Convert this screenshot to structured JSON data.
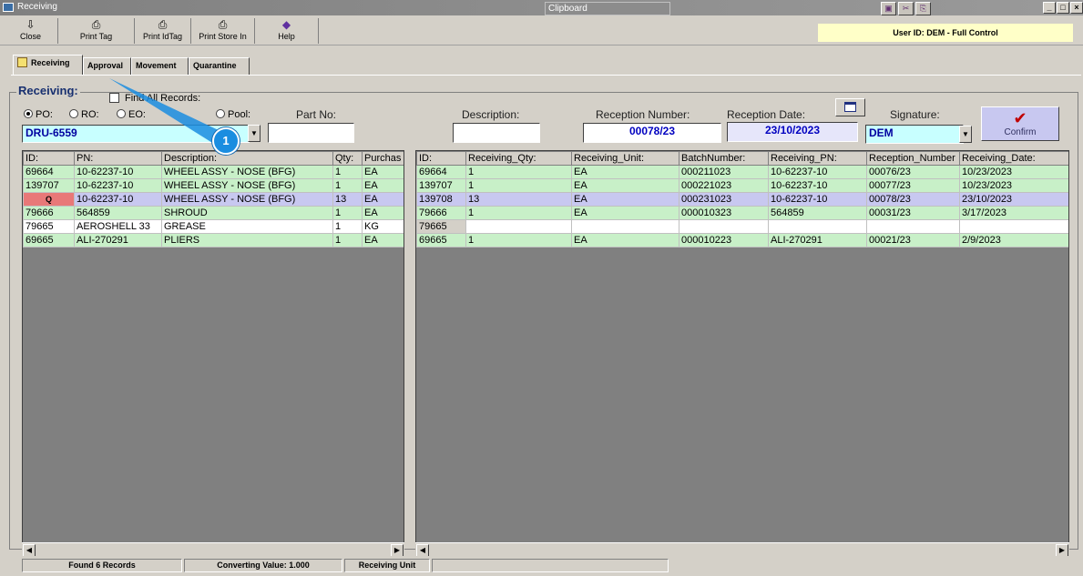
{
  "window": {
    "title": "Receiving",
    "clipboard_label": "Clipboard",
    "controls": [
      "_",
      "□",
      "×"
    ]
  },
  "toolbar": {
    "buttons": [
      {
        "label": "Close",
        "icon": "close-icon"
      },
      {
        "label": "Print Tag",
        "icon": "printer-icon"
      },
      {
        "label": "Print IdTag",
        "icon": "printer-icon"
      },
      {
        "label": "Print Store In",
        "icon": "printer-icon"
      },
      {
        "label": "Help",
        "icon": "help-icon"
      }
    ],
    "user_info": "User ID: DEM - Full Control"
  },
  "tabs": [
    {
      "label": "Receiving",
      "active": true
    },
    {
      "label": "Approval",
      "active": false
    },
    {
      "label": "Movement",
      "active": false
    },
    {
      "label": "Quarantine",
      "active": false
    }
  ],
  "form": {
    "group_title": "Receiving:",
    "all_records_label": "Find All Records:",
    "source_options": [
      {
        "label": "PO:",
        "selected": true
      },
      {
        "label": "RO:",
        "selected": false
      },
      {
        "label": "EO:",
        "selected": false
      },
      {
        "label": "Pool:",
        "selected": false
      }
    ],
    "order_number": "DRU-6559",
    "part_no_label": "Part No:",
    "part_no_value": "",
    "description_label": "Description:",
    "description_value": "",
    "reception_number_label": "Reception Number:",
    "reception_number_value": "00078/23",
    "reception_date_label": "Reception Date:",
    "reception_date_value": "23/10/2023",
    "signature_label": "Signature:",
    "signature_value": "DEM",
    "confirm_label": "Confirm"
  },
  "left_grid": {
    "columns": [
      "ID:",
      "PN:",
      "Description:",
      "Qty:",
      "Purchas"
    ],
    "rows": [
      {
        "id": "69664",
        "pn": "10-62237-10",
        "desc": "WHEEL ASSY - NOSE (BFG)",
        "qty": "1",
        "unit": "EA",
        "style": "g"
      },
      {
        "id": "139707",
        "pn": "10-62237-10",
        "desc": "WHEEL ASSY - NOSE (BFG)",
        "qty": "1",
        "unit": "EA",
        "style": "g"
      },
      {
        "id": "Q",
        "pn": "10-62237-10",
        "desc": "WHEEL ASSY - NOSE (BFG)",
        "qty": "13",
        "unit": "EA",
        "style": "sel"
      },
      {
        "id": "79666",
        "pn": "564859",
        "desc": "SHROUD",
        "qty": "1",
        "unit": "EA",
        "style": "g"
      },
      {
        "id": "79665",
        "pn": "AEROSHELL 33",
        "desc": "GREASE",
        "qty": "1",
        "unit": "KG",
        "style": "w"
      },
      {
        "id": "69665",
        "pn": "ALI-270291",
        "desc": "PLIERS",
        "qty": "1",
        "unit": "EA",
        "style": "g"
      }
    ]
  },
  "right_grid": {
    "columns": [
      "ID:",
      "Receiving_Qty:",
      "Receiving_Unit:",
      "BatchNumber:",
      "Receiving_PN:",
      "Reception_Number",
      "Receiving_Date:"
    ],
    "rows": [
      {
        "id": "69664",
        "qty": "1",
        "unit": "EA",
        "batch": "000211023",
        "pn": "10-62237-10",
        "recno": "00076/23",
        "date": "10/23/2023",
        "style": "g"
      },
      {
        "id": "139707",
        "qty": "1",
        "unit": "EA",
        "batch": "000221023",
        "pn": "10-62237-10",
        "recno": "00077/23",
        "date": "10/23/2023",
        "style": "g"
      },
      {
        "id": "139708",
        "qty": "13",
        "unit": "EA",
        "batch": "000231023",
        "pn": "10-62237-10",
        "recno": "00078/23",
        "date": "23/10/2023",
        "style": "sel"
      },
      {
        "id": "79666",
        "qty": "1",
        "unit": "EA",
        "batch": "000010323",
        "pn": "564859",
        "recno": "00031/23",
        "date": "3/17/2023",
        "style": "g"
      },
      {
        "id": "79665",
        "qty": "",
        "unit": "",
        "batch": "",
        "pn": "",
        "recno": "",
        "date": "",
        "style": "w"
      },
      {
        "id": "69665",
        "qty": "1",
        "unit": "EA",
        "batch": "000010223",
        "pn": "ALI-270291",
        "recno": "00021/23",
        "date": "2/9/2023",
        "style": "g"
      }
    ]
  },
  "status": {
    "found": "Found 6 Records",
    "converting": "Converting Value: 1.000",
    "unit": "Receiving Unit"
  },
  "callout": {
    "number": "1"
  }
}
